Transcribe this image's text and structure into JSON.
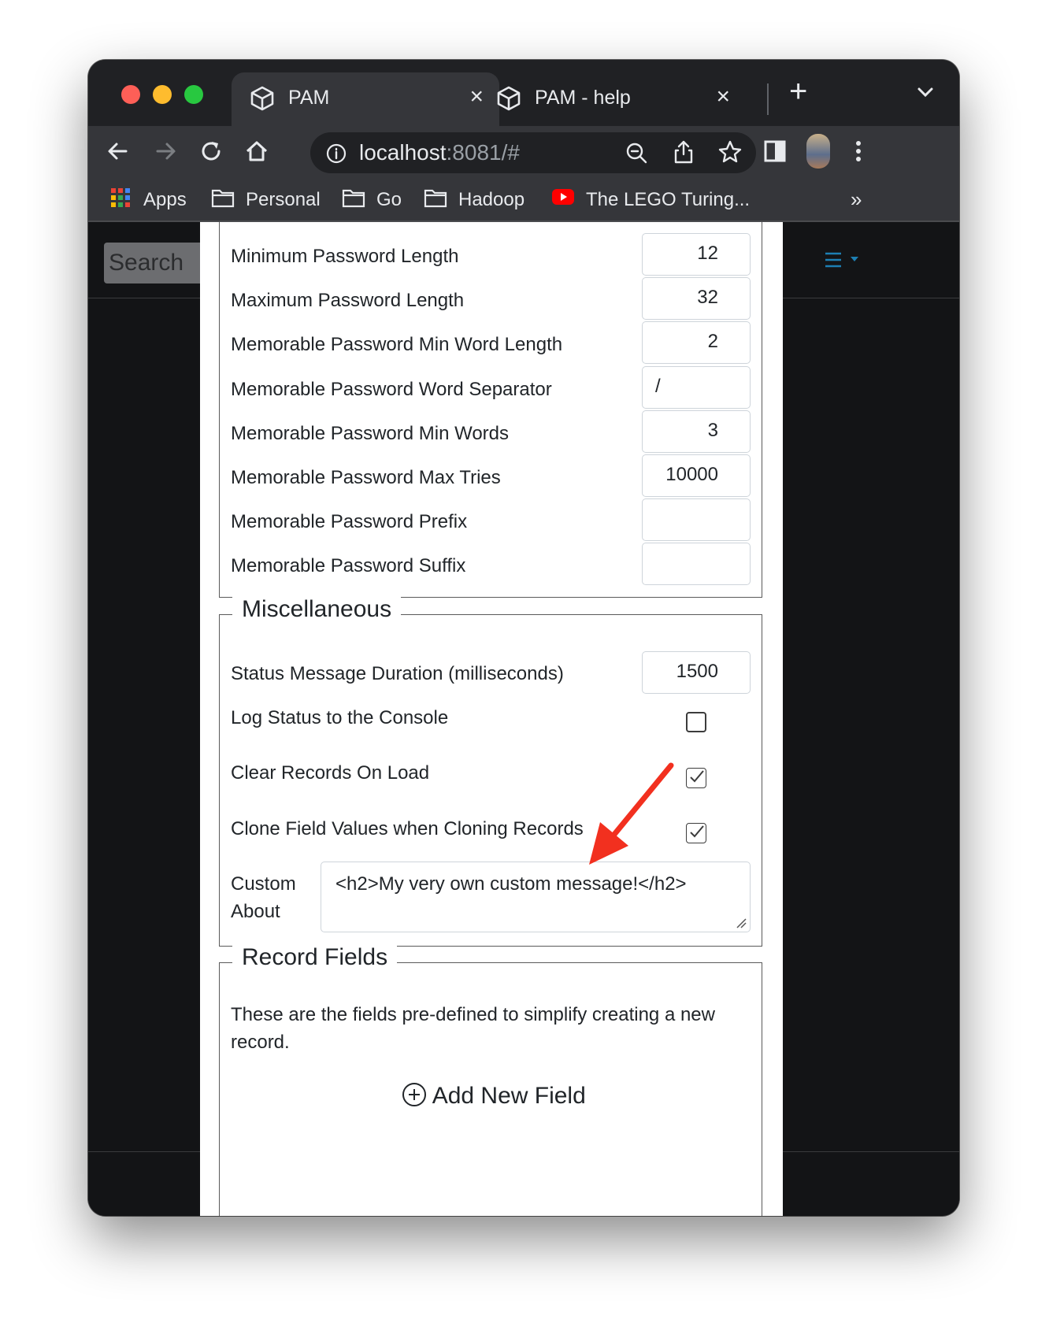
{
  "browser": {
    "tabs": [
      {
        "title": "PAM",
        "active": true
      },
      {
        "title": "PAM - help",
        "active": false
      }
    ],
    "new_tab_icon": "plus-icon",
    "address": {
      "host": "localhost",
      "port_path": ":8081/#"
    },
    "bookmarks": [
      {
        "label": "Apps",
        "icon": "apps-grid-icon"
      },
      {
        "label": "Personal",
        "icon": "folder-icon"
      },
      {
        "label": "Go",
        "icon": "folder-icon"
      },
      {
        "label": "Hadoop",
        "icon": "folder-icon"
      },
      {
        "label": "The LEGO Turing...",
        "icon": "youtube-icon"
      }
    ],
    "bookmarks_overflow": "»"
  },
  "page": {
    "search_placeholder": "Search",
    "password_settings": [
      {
        "label": "Minimum Password Length",
        "value": "12"
      },
      {
        "label": "Maximum Password Length",
        "value": "32"
      },
      {
        "label": "Memorable Password Min Word Length",
        "value": "2"
      },
      {
        "label": "Memorable Password Word Separator",
        "value": "/"
      },
      {
        "label": "Memorable Password Min Words",
        "value": "3"
      },
      {
        "label": "Memorable Password Max Tries",
        "value": "10000"
      },
      {
        "label": "Memorable Password Prefix",
        "value": ""
      },
      {
        "label": "Memorable Password Suffix",
        "value": ""
      }
    ],
    "misc": {
      "legend": "Miscellaneous",
      "status_duration": {
        "label": "Status Message Duration (milliseconds)",
        "value": "1500"
      },
      "log_status": {
        "label": "Log Status to the Console",
        "checked": false
      },
      "clear_records": {
        "label": "Clear Records On Load",
        "checked": true
      },
      "clone_values": {
        "label": "Clone Field Values when Cloning Records",
        "checked": true
      },
      "custom_about": {
        "label_line1": "Custom",
        "label_line2": "About",
        "value": "<h2>My very own custom message!</h2>"
      }
    },
    "record_fields": {
      "legend": "Record Fields",
      "description_line1": "These are the fields pre-defined to simplify creating a new",
      "description_line2": "record.",
      "add_button": "Add New Field"
    },
    "annotation_arrow_color": "#f2301f"
  }
}
